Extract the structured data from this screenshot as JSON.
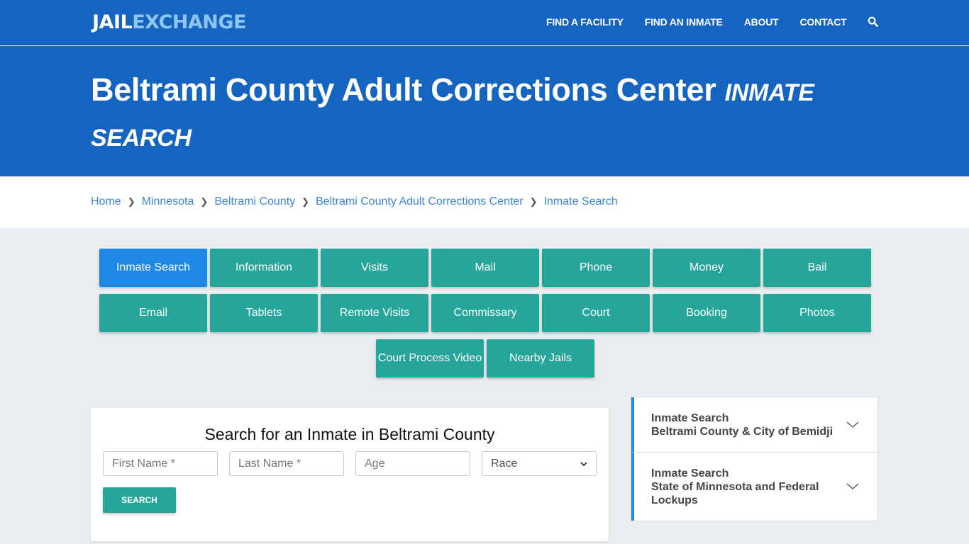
{
  "header": {
    "logo_part1": "JAIL",
    "logo_part2": "EXCHANGE",
    "nav": [
      "FIND A FACILITY",
      "FIND AN INMATE",
      "ABOUT",
      "CONTACT"
    ],
    "search_icon": "search-icon"
  },
  "hero": {
    "title": "Beltrami County Adult Corrections Center",
    "subtitle": "INMATE SEARCH"
  },
  "breadcrumb": [
    "Home",
    "Minnesota",
    "Beltrami County",
    "Beltrami County Adult Corrections Center",
    "Inmate Search"
  ],
  "tabs": {
    "row1": [
      "Inmate Search",
      "Information",
      "Visits",
      "Mail",
      "Phone",
      "Money",
      "Bail"
    ],
    "row2": [
      "Email",
      "Tablets",
      "Remote Visits",
      "Commissary",
      "Court",
      "Booking",
      "Photos"
    ],
    "row3": [
      "Court Process Video",
      "Nearby Jails"
    ],
    "active": "Inmate Search"
  },
  "search_form": {
    "title": "Search for an Inmate in Beltrami County",
    "first_name_placeholder": "First Name *",
    "last_name_placeholder": "Last Name *",
    "age_placeholder": "Age",
    "race_selected": "Race",
    "submit_label": "SEARCH"
  },
  "sidebar": {
    "items": [
      {
        "line1": "Inmate Search",
        "line2": "Beltrami County & City of Bemidji"
      },
      {
        "line1": "Inmate Search",
        "line2": "State of Minnesota and Federal Lockups"
      }
    ]
  },
  "colors": {
    "brand_blue": "#1565c0",
    "active_tab": "#1e88e5",
    "teal": "#26a69a",
    "link": "#3a86d4"
  }
}
